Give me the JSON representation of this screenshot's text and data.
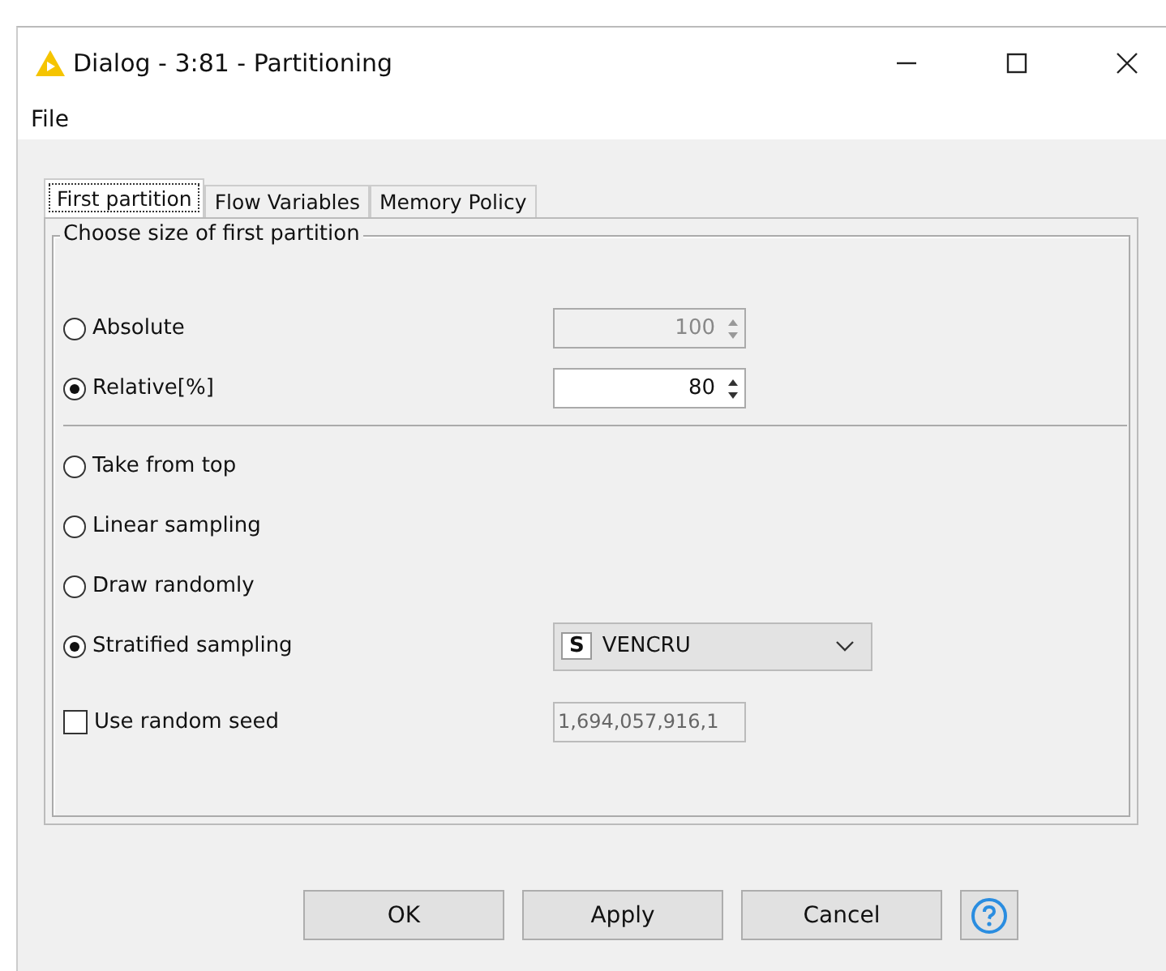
{
  "window": {
    "title": "Dialog - 3:81 - Partitioning"
  },
  "menu": [
    "File"
  ],
  "tabs": [
    {
      "label": "First partition",
      "selected": true
    },
    {
      "label": "Flow Variables",
      "selected": false
    },
    {
      "label": "Memory Policy",
      "selected": false
    }
  ],
  "group": {
    "title": "Choose size of first partition"
  },
  "size_options": [
    {
      "label": "Absolute",
      "selected": false,
      "value": "100",
      "disabled": true
    },
    {
      "label": "Relative[%]",
      "selected": true,
      "value": "80",
      "disabled": false
    }
  ],
  "sampling_options": [
    {
      "kind": "radio",
      "label": "Take from top",
      "selected": false
    },
    {
      "kind": "radio",
      "label": "Linear sampling",
      "selected": false
    },
    {
      "kind": "radio",
      "label": "Draw randomly",
      "selected": false
    },
    {
      "kind": "radio_combo",
      "label": "Stratified sampling",
      "selected": true,
      "type_badge": "S",
      "column": "VENCRU"
    }
  ],
  "seed": {
    "label": "Use random seed",
    "checked": false,
    "value": "1,694,057,916,1",
    "disabled": true
  },
  "buttons": [
    {
      "label": "OK"
    },
    {
      "label": "Apply"
    },
    {
      "label": "Cancel"
    }
  ]
}
